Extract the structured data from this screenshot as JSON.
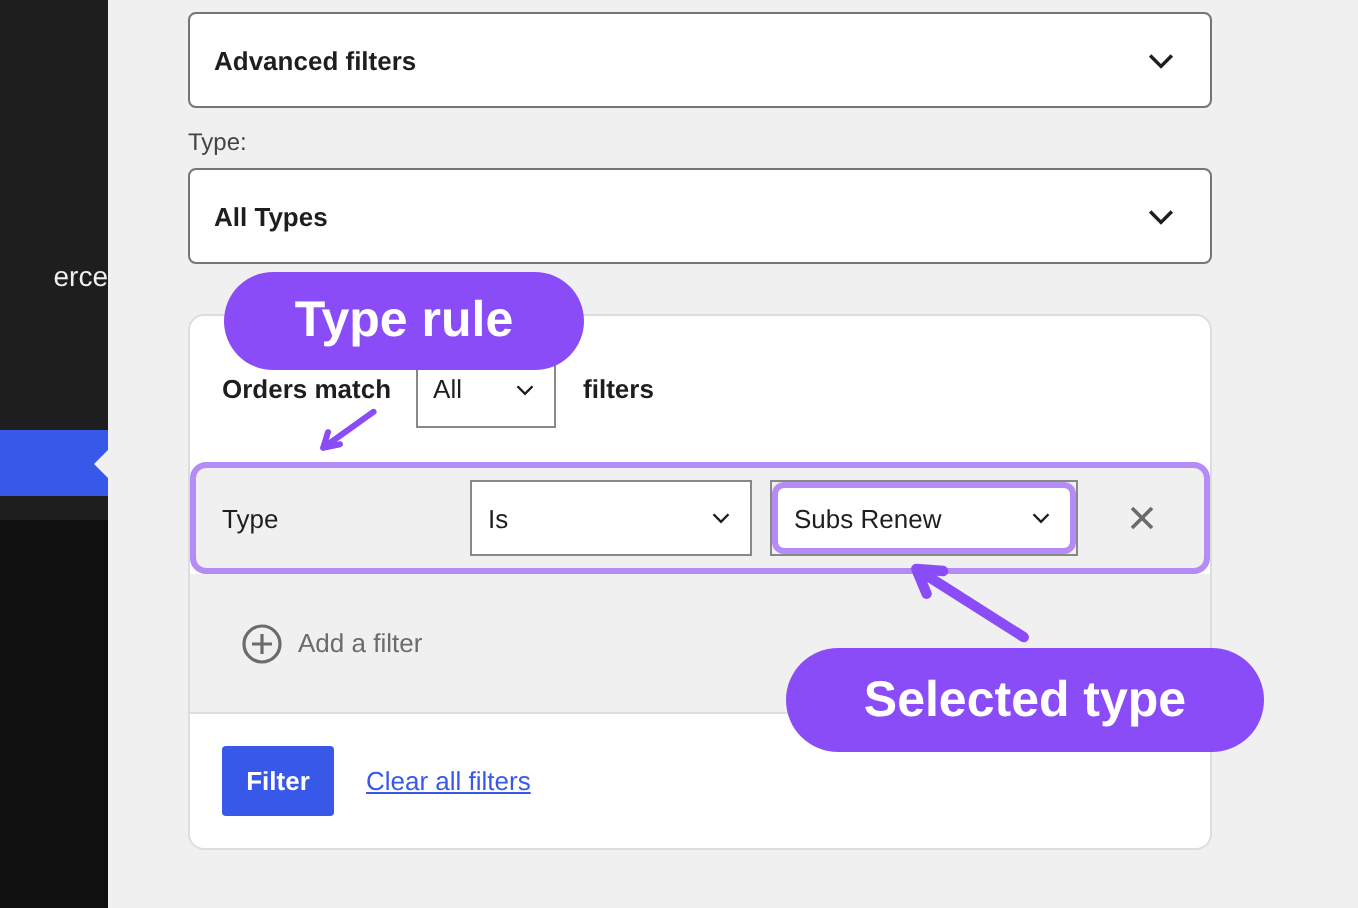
{
  "sidebar": {
    "items": [
      {
        "label": "erce",
        "selected": false
      },
      {
        "selected": true
      }
    ]
  },
  "advanced_filters": {
    "value": "Advanced filters"
  },
  "type_filter": {
    "label": "Type:",
    "value": "All Types"
  },
  "filter_panel": {
    "match_label": "Orders match",
    "match_value": "All",
    "match_suffix": "filters",
    "rules": [
      {
        "field": "Type",
        "operator": "Is",
        "value": "Subs Renew",
        "highlighted": true
      }
    ],
    "add_filter": "Add a filter",
    "filter_button": "Filter",
    "clear_link": "Clear all filters"
  },
  "annotations": [
    {
      "kind": "rule",
      "text": "Type rule"
    },
    {
      "kind": "selected",
      "text": "Selected type"
    }
  ]
}
